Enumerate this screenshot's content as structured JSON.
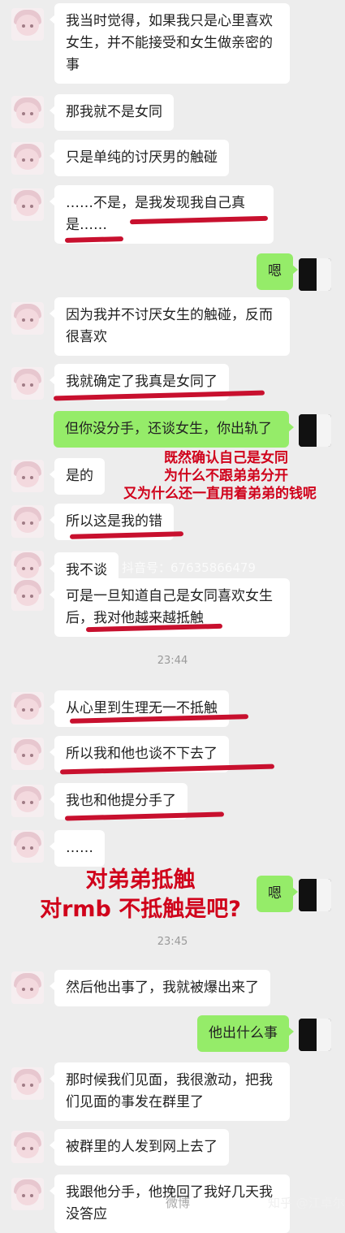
{
  "messages": [
    {
      "side": "left",
      "text": "我当时觉得，如果我只是心里喜欢女生，并不能接受和女生做亲密的事"
    },
    {
      "side": "left",
      "text": "那我就不是女同"
    },
    {
      "side": "left",
      "text": "只是单纯的讨厌男的触碰"
    },
    {
      "side": "left",
      "text": "……不是，是我发现我自己真是……"
    },
    {
      "side": "right",
      "text": "嗯"
    },
    {
      "side": "left",
      "text": "因为我并不讨厌女生的触碰，反而很喜欢"
    },
    {
      "side": "left",
      "text": "我就确定了我真是女同了"
    },
    {
      "side": "right",
      "text": "但你没分手，还谈女生，你出轨了"
    },
    {
      "side": "left",
      "text": "是的"
    },
    {
      "side": "left",
      "text": "所以这是我的错"
    },
    {
      "side": "left",
      "text": "我不谈"
    },
    {
      "side": "left",
      "text": "可是一旦知道自己是女同喜欢女生后，我对他越来越抵触"
    },
    {
      "side": "left",
      "text": "从心里到生理无一不抵触"
    },
    {
      "side": "left",
      "text": "所以我和他也谈不下去了"
    },
    {
      "side": "left",
      "text": "我也和他提分手了"
    },
    {
      "side": "left",
      "text": "……"
    },
    {
      "side": "right",
      "text": "嗯"
    },
    {
      "side": "left",
      "text": "然后他出事了，我就被爆出来了"
    },
    {
      "side": "right",
      "text": "他出什么事"
    },
    {
      "side": "left",
      "text": "那时候我们见面，我很激动，把我们见面的事发在群里了"
    },
    {
      "side": "left",
      "text": "被群里的人发到网上去了"
    },
    {
      "side": "left",
      "text": "我跟他分手，他挽回了我好几天我没答应"
    }
  ],
  "timestamps": [
    "23:44",
    "23:45"
  ],
  "annotations": {
    "note1": [
      "既然确认自己是女同",
      "为什么不跟弟弟分开",
      "又为什么还一直用着弟弟的钱呢"
    ],
    "note2": [
      "对弟弟抵触",
      "对rmb 不抵触是吧?"
    ]
  },
  "watermarks": {
    "douyin": "抖音号：67635866479",
    "zhihu": "知乎 @江卓尔",
    "weibo": "微博"
  },
  "colors": {
    "annotation": "#d0021b",
    "sent_bubble": "#95ec69",
    "received_bubble": "#ffffff",
    "background": "#ededed"
  }
}
